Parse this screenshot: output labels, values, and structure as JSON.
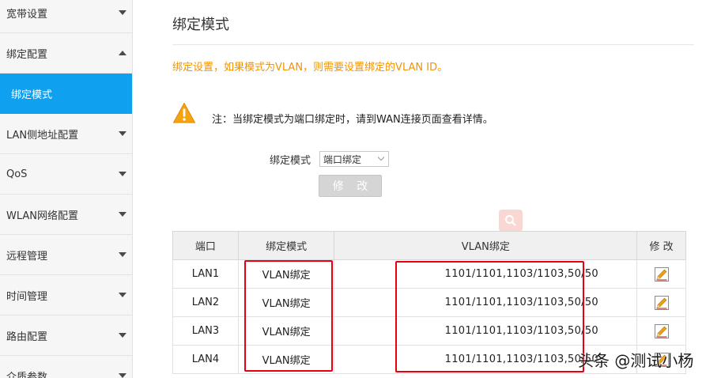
{
  "sidebar": {
    "items": [
      {
        "label": "宽带设置",
        "caret": "down"
      },
      {
        "label": "绑定配置",
        "caret": "up"
      },
      {
        "label": "绑定模式",
        "active": true
      },
      {
        "label": "LAN侧地址配置",
        "caret": "down"
      },
      {
        "label": "QoS",
        "caret": "down"
      },
      {
        "label": "WLAN网络配置",
        "caret": "down"
      },
      {
        "label": "远程管理",
        "caret": "down"
      },
      {
        "label": "时间管理",
        "caret": "down"
      },
      {
        "label": "路由配置",
        "caret": "down"
      },
      {
        "label": "介质参数",
        "caret": "down"
      }
    ]
  },
  "main": {
    "title": "绑定模式",
    "hint": "绑定设置，如果模式为VLAN，则需要设置绑定的VLAN ID。",
    "note": "注：当绑定模式为端口绑定时，请到WAN连接页面查看详情。",
    "warning_icon": "warning-triangle-icon",
    "mode_label": "绑定模式",
    "mode_value": "端口绑定",
    "modify_button": "修 改"
  },
  "table": {
    "headers": [
      "端口",
      "绑定模式",
      "VLAN绑定",
      "修 改"
    ],
    "rows": [
      {
        "port": "LAN1",
        "mode": "VLAN绑定",
        "vlan": "1101/1101,1103/1103,50/50"
      },
      {
        "port": "LAN2",
        "mode": "VLAN绑定",
        "vlan": "1101/1101,1103/1103,50/50"
      },
      {
        "port": "LAN3",
        "mode": "VLAN绑定",
        "vlan": "1101/1101,1103/1103,50/50"
      },
      {
        "port": "LAN4",
        "mode": "VLAN绑定",
        "vlan": "1101/1101,1103/1103,50/50"
      }
    ]
  },
  "watermark": "头条 @测试小杨",
  "colors": {
    "accent": "#0fa0ef",
    "hint": "#f29300",
    "highlight": "#e60012"
  }
}
